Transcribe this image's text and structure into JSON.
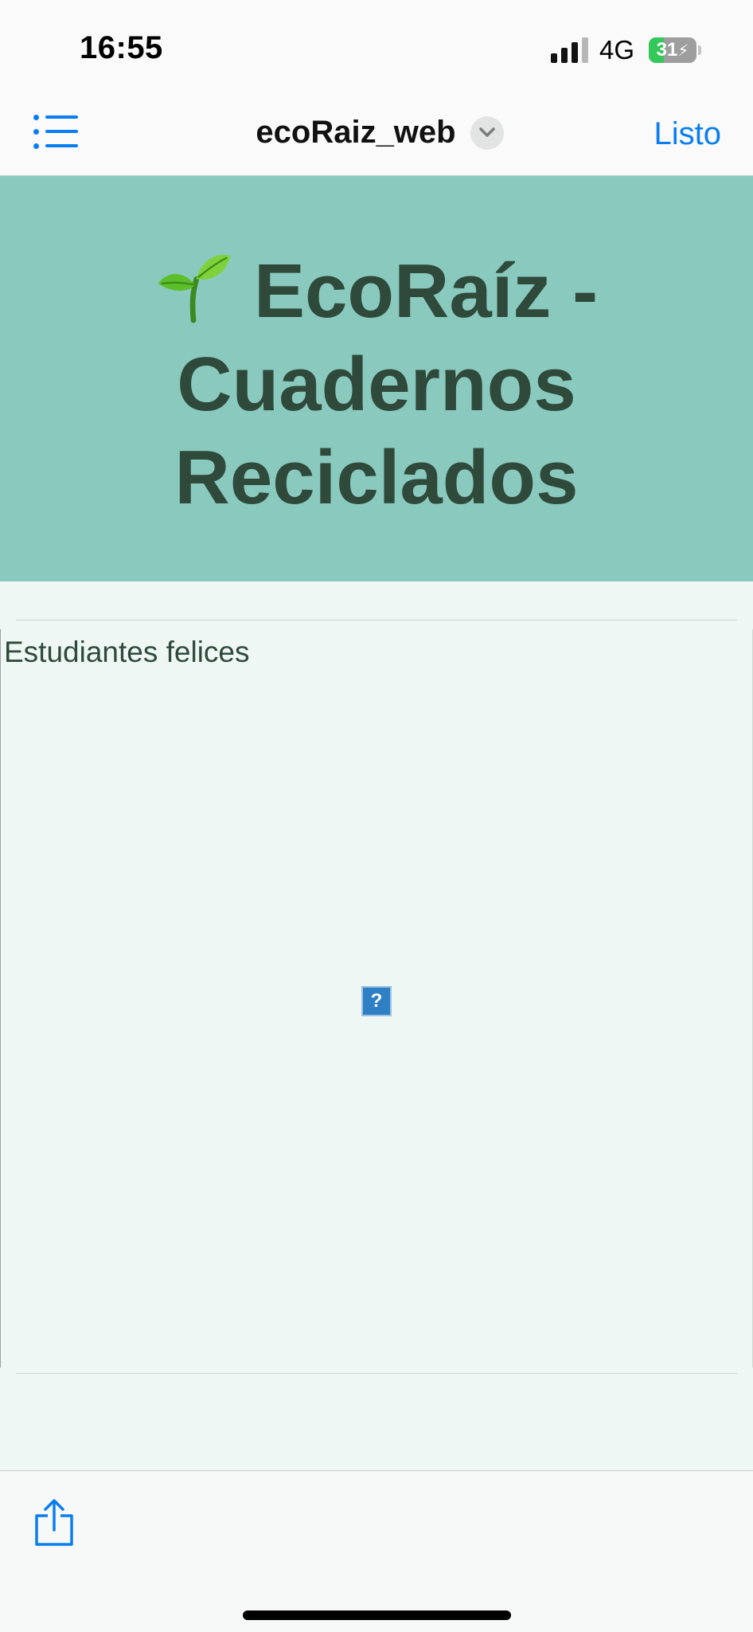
{
  "status_bar": {
    "time": "16:55",
    "network": "4G",
    "battery_percent": "31",
    "battery_level": 0.31,
    "charging": true
  },
  "nav": {
    "title": "ecoRaiz_web",
    "done_label": "Listo",
    "accent_color": "#0a7df2"
  },
  "page": {
    "header_title": "EcoRaíz - Cuadernos Reciclados",
    "header_emoji_icon": "sprout-icon",
    "header_bg_color": "#8ac9be",
    "text_color": "#2f4a3b",
    "body_bg_color": "#eef7f3",
    "image_alt": "Estudiantes felices",
    "broken_image_glyph": "?"
  },
  "toolbar": {
    "share_icon": "share-icon"
  }
}
